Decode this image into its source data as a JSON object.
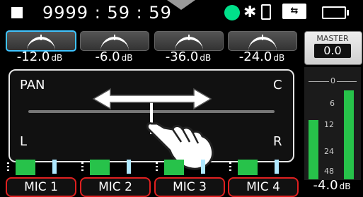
{
  "status_bar": {
    "timecode": "9999 : 59 : 59",
    "stop_icon": "stop-icon",
    "record_indicator_color": "#00e08a",
    "bluetooth_icon": "bluetooth-icon",
    "phone_icon": "phone-icon",
    "usb_icon": "usb-icon",
    "battery_icon": "battery-icon"
  },
  "channels": [
    {
      "name": "MIC 1",
      "gain_value": "-12.0",
      "unit": "dB",
      "selected": true
    },
    {
      "name": "MIC 2",
      "gain_value": "-6.0",
      "unit": "dB",
      "selected": false
    },
    {
      "name": "MIC 3",
      "gain_value": "-36.0",
      "unit": "dB",
      "selected": false
    },
    {
      "name": "MIC 4",
      "gain_value": "-24.0",
      "unit": "dB",
      "selected": false
    }
  ],
  "master": {
    "label": "MASTER",
    "value": "0.0",
    "scale": [
      "0",
      "6",
      "12",
      "24",
      "48"
    ],
    "level_value": "-4.0",
    "unit": "dB"
  },
  "pan": {
    "title": "PAN",
    "center_label": "C",
    "left_label": "L",
    "right_label": "R"
  },
  "colors": {
    "accent_selected": "#3fc3ff",
    "meter_green": "#27c24a",
    "mic_border": "#e02020"
  }
}
